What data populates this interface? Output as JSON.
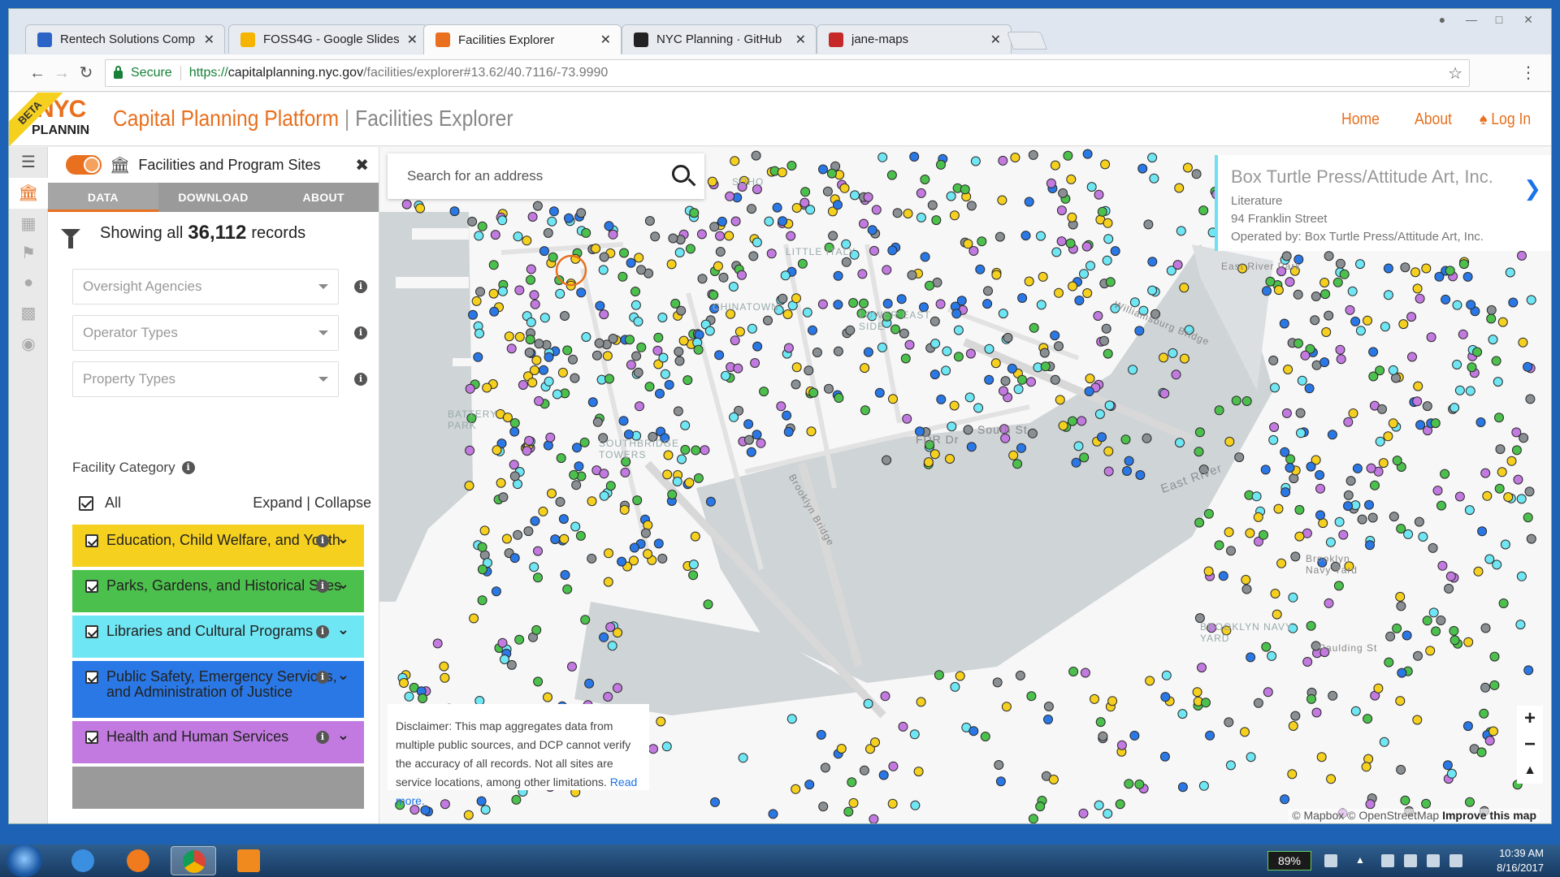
{
  "browser": {
    "tabs": [
      {
        "label": "Rentech Solutions Comp",
        "favicon_color": "#2b63c6",
        "active": false
      },
      {
        "label": "FOSS4G - Google Slides",
        "favicon_color": "#f4b400",
        "active": false
      },
      {
        "label": "Facilities Explorer",
        "favicon_color": "#e8701e",
        "active": true
      },
      {
        "label": "NYC Planning · GitHub",
        "favicon_color": "#222222",
        "active": false
      },
      {
        "label": "jane-maps",
        "favicon_color": "#c62828",
        "active": false
      }
    ],
    "secure_label": "Secure",
    "url_scheme": "https://",
    "url_domain": "capitalplanning.nyc.gov",
    "url_path": "/facilities/explorer#13.62/40.7116/-73.9990"
  },
  "header": {
    "beta": "BETA",
    "logo_top": "NYC",
    "logo_bottom": "PLANNING",
    "brand": "Capital Planning Platform",
    "divider": "|",
    "subtitle": "Facilities Explorer",
    "nav": {
      "home": "Home",
      "about": "About",
      "login": "Log In"
    }
  },
  "panel": {
    "title": "Facilities and Program Sites",
    "tabs": [
      "DATA",
      "DOWNLOAD",
      "ABOUT"
    ],
    "records_prefix": "Showing all",
    "records_count": "36,112",
    "records_suffix": "records",
    "filters": [
      "Oversight Agencies",
      "Operator Types",
      "Property Types"
    ],
    "category_heading": "Facility Category",
    "all_label": "All",
    "expand_label": "Expand",
    "collapse_label": "Collapse",
    "categories": [
      {
        "label": "Education, Child Welfare, and Youth",
        "color": "#f5d01f"
      },
      {
        "label": "Parks, Gardens, and Historical Sites",
        "color": "#4cc04c"
      },
      {
        "label": "Libraries and Cultural Programs",
        "color": "#6fe6f3"
      },
      {
        "label": "Public Safety, Emergency Services, and Administration of Justice",
        "color": "#2a78e6"
      },
      {
        "label": "Health and Human Services",
        "color": "#c37ae0"
      }
    ]
  },
  "map": {
    "search_placeholder": "Search for an address",
    "popup": {
      "name": "Box Turtle Press/Attitude Art, Inc.",
      "category": "Literature",
      "address": "94 Franklin Street",
      "operator": "Operated by: Box Turtle Press/Attitude Art, Inc."
    },
    "disclaimer": "Disclaimer: This map aggregates data from multiple public sources, and DCP cannot verify the accuracy of all records. Not all sites are service locations, among other limitations.",
    "disclaimer_link": "Read more.",
    "attribution_mapbox": "© Mapbox",
    "attribution_osm": "© OpenStreetMap",
    "attribution_improve": "Improve this map",
    "labels": [
      "CHINATOWN",
      "LOWER EAST SIDE",
      "BATTERY PARK",
      "SOUTHBRIDGE TOWERS",
      "East River",
      "South St",
      "FDR Dr",
      "Williamsburg Bridge",
      "Brooklyn Bridge",
      "Brooklyn Navy Yard",
      "BROOKLYN NAVY YARD",
      "East River Park",
      "Paulding St",
      "SOHO",
      "LITTLE ITALY"
    ],
    "point_colors": [
      "#f5d01f",
      "#4cc04c",
      "#6fe6f3",
      "#2a78e6",
      "#c37ae0",
      "#8a8f93"
    ]
  },
  "taskbar": {
    "battery": "89%",
    "time": "10:39 AM",
    "date": "8/16/2017"
  }
}
